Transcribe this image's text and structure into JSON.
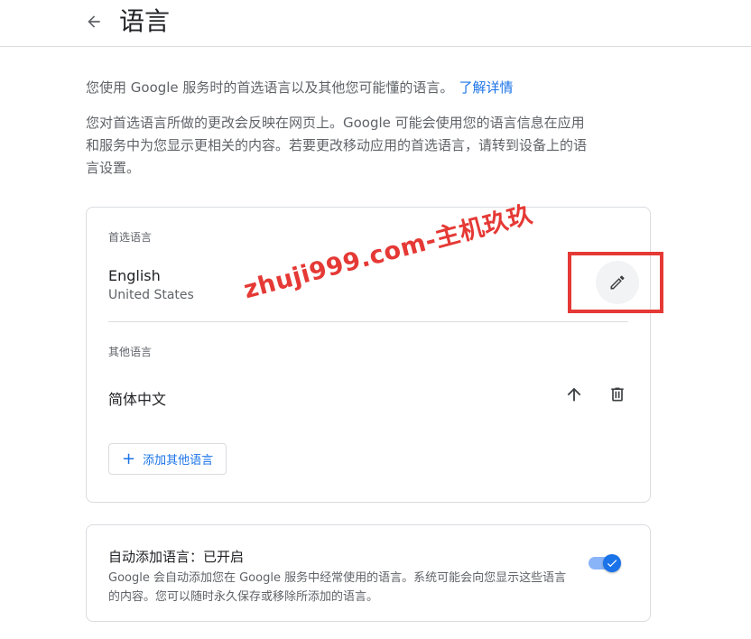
{
  "header": {
    "title": "语言"
  },
  "intro": {
    "text": "您使用 Google 服务时的首选语言以及其他您可能懂的语言。",
    "link": "了解详情"
  },
  "description": "您对首选语言所做的更改会反映在网页上。Google 可能会使用您的语言信息在应用和服务中为您显示更相关的内容。若要更改移动应用的首选语言，请转到设备上的语言设置。",
  "preferred": {
    "label": "首选语言",
    "language": "English",
    "region": "United States"
  },
  "other": {
    "label": "其他语言",
    "languages": [
      {
        "name": "简体中文"
      }
    ],
    "add_button": "添加其他语言"
  },
  "auto_add": {
    "title": "自动添加语言：已开启",
    "description": "Google 会自动添加您在 Google 服务中经常使用的语言。系统可能会向您显示这些语言的内容。您可以随时永久保存或移除所添加的语言。",
    "enabled": true
  },
  "watermark": "zhuji999.com-主机玖玖",
  "colors": {
    "accent": "#1a73e8",
    "highlight": "#e53935",
    "text_secondary": "#5f6368"
  }
}
